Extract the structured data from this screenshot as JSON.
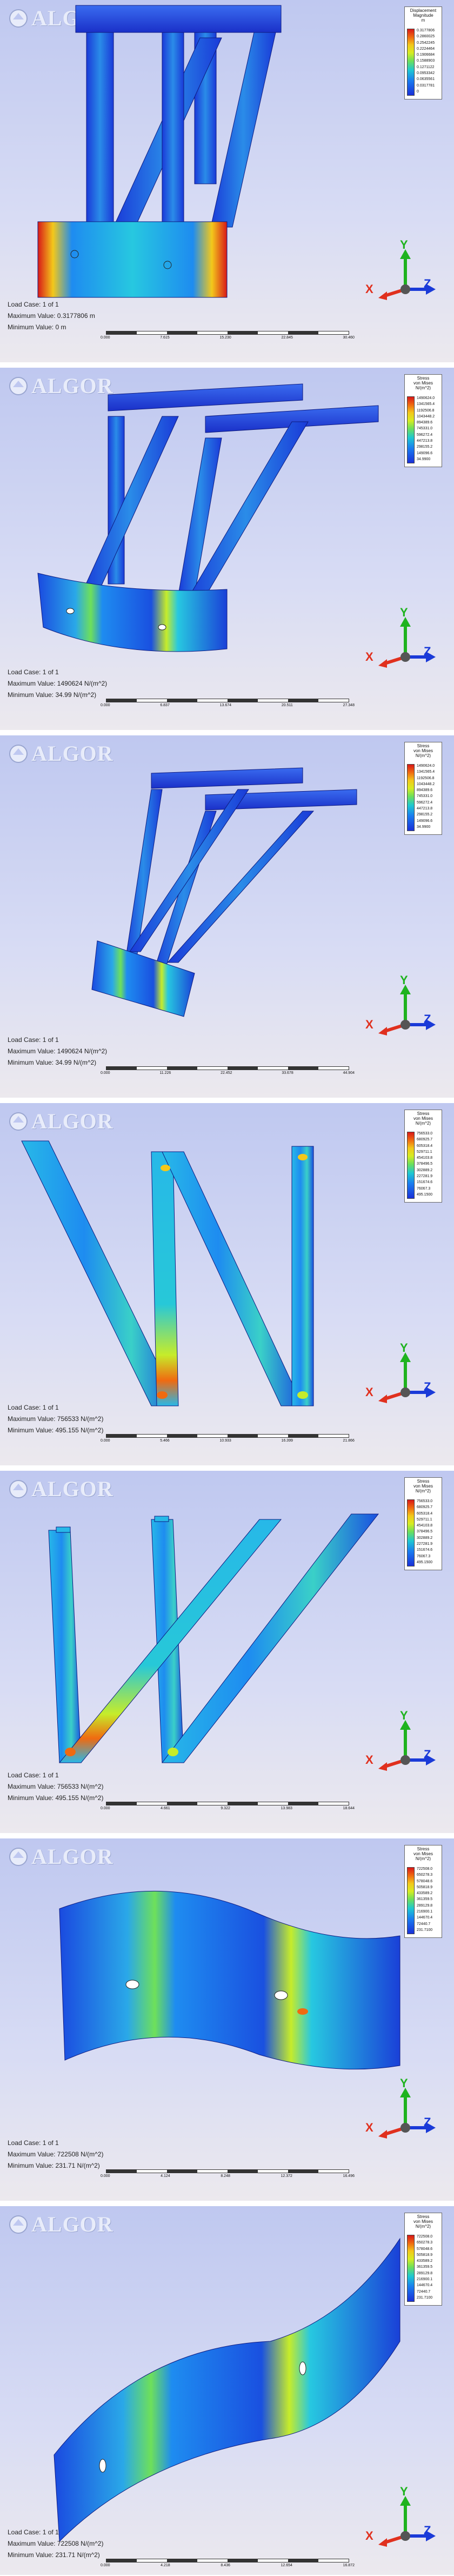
{
  "brand": {
    "name": "ALGOR"
  },
  "colors": {
    "contour_high": "#d81818",
    "contour_mid": "#6ee05a",
    "contour_low": "#1a30d8",
    "axis_x": "#e0301e",
    "axis_y": "#1fb31f",
    "axis_z": "#1a3ad8"
  },
  "axes": {
    "x": "X",
    "y": "Y",
    "z": "Z"
  },
  "panels": [
    {
      "legend": {
        "title": [
          "Displacement",
          "Magnitude",
          "m"
        ],
        "values": [
          "0.3177806",
          "0.2860025",
          "0.2542245",
          "0.2224464",
          "0.1906684",
          "0.1588903",
          "0.1271122",
          "0.0953342",
          "0.0635561",
          "0.0317781",
          "0"
        ]
      },
      "load_case": "Load Case:  1 of 1",
      "max": "Maximum Value: 0.3177806 m",
      "min": "Minimum Value: 0 m",
      "scale": [
        "0.000",
        "7.615",
        "15.230",
        "22.845",
        "30.460"
      ]
    },
    {
      "legend": {
        "title": [
          "Stress",
          "von Mises",
          "N/(m^2)"
        ],
        "values": [
          "1490624.0",
          "1341565.4",
          "1192506.8",
          "1043448.2",
          "894389.6",
          "745331.0",
          "596272.4",
          "447213.8",
          "298155.2",
          "149096.6",
          "34.9900"
        ]
      },
      "load_case": "Load Case:  1 of 1",
      "max": "Maximum Value: 1490624 N/(m^2)",
      "min": "Minimum Value: 34.99 N/(m^2)",
      "scale": [
        "0.000",
        "6.837",
        "13.674",
        "20.511",
        "27.348"
      ]
    },
    {
      "legend": {
        "title": [
          "Stress",
          "von Mises",
          "N/(m^2)"
        ],
        "values": [
          "1490624.0",
          "1341565.4",
          "1192506.8",
          "1043448.2",
          "894389.6",
          "745331.0",
          "596272.4",
          "447213.8",
          "298155.2",
          "149096.6",
          "34.9900"
        ]
      },
      "load_case": "Load Case:  1 of 1",
      "max": "Maximum Value: 1490624 N/(m^2)",
      "min": "Minimum Value: 34.99 N/(m^2)",
      "scale": [
        "0.000",
        "11.226",
        "22.452",
        "33.678",
        "44.904"
      ]
    },
    {
      "legend": {
        "title": [
          "Stress",
          "von Mises",
          "N/(m^2)"
        ],
        "values": [
          "756533.0",
          "680925.7",
          "605318.4",
          "529711.1",
          "454103.8",
          "378496.5",
          "302889.2",
          "227281.9",
          "151674.6",
          "76067.3",
          "495.1500"
        ]
      },
      "load_case": "Load Case:  1 of 1",
      "max": "Maximum Value: 756533 N/(m^2)",
      "min": "Minimum Value: 495.155 N/(m^2)",
      "scale": [
        "0.000",
        "5.466",
        "10.933",
        "16.399",
        "21.866"
      ]
    },
    {
      "legend": {
        "title": [
          "Stress",
          "von Mises",
          "N/(m^2)"
        ],
        "values": [
          "756533.0",
          "680925.7",
          "605318.4",
          "529711.1",
          "454103.8",
          "378496.5",
          "302889.2",
          "227281.9",
          "151674.6",
          "76067.3",
          "495.1500"
        ]
      },
      "load_case": "Load Case:  1 of 1",
      "max": "Maximum Value: 756533 N/(m^2)",
      "min": "Minimum Value: 495.155 N/(m^2)",
      "scale": [
        "0.000",
        "4.661",
        "9.322",
        "13.983",
        "18.644"
      ]
    },
    {
      "legend": {
        "title": [
          "Stress",
          "von Mises",
          "N/(m^2)"
        ],
        "values": [
          "722508.0",
          "650278.3",
          "578048.6",
          "505818.9",
          "433589.2",
          "361359.5",
          "289129.8",
          "216900.1",
          "144670.4",
          "72440.7",
          "231.7100"
        ]
      },
      "load_case": "Load Case:  1 of 1",
      "max": "Maximum Value: 722508 N/(m^2)",
      "min": "Minimum Value: 231.71 N/(m^2)",
      "scale": [
        "0.000",
        "4.124",
        "8.248",
        "12.372",
        "16.496"
      ]
    },
    {
      "legend": {
        "title": [
          "Stress",
          "von Mises",
          "N/(m^2)"
        ],
        "values": [
          "722508.0",
          "650278.3",
          "578048.6",
          "505818.9",
          "433589.2",
          "361359.5",
          "289129.8",
          "216900.1",
          "144670.4",
          "72440.7",
          "231.7100"
        ]
      },
      "load_case": "Load Case:  1 of 1",
      "max": "Maximum Value: 722508 N/(m^2)",
      "min": "Minimum Value: 231.71 N/(m^2)",
      "scale": [
        "0.000",
        "4.218",
        "8.436",
        "12.654",
        "16.872"
      ]
    }
  ]
}
